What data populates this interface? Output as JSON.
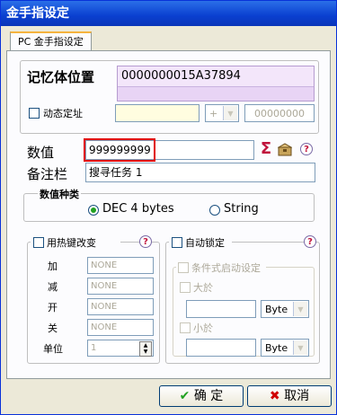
{
  "window": {
    "title": "金手指设定"
  },
  "tab": {
    "label": "PC 金手指设定"
  },
  "memory": {
    "label": "记忆体位置",
    "address": "0000000015A37894",
    "dynamic_label": "动态定址",
    "offset_sign": "+",
    "offset_value": "00000000"
  },
  "value": {
    "label": "数值",
    "input": "999999999"
  },
  "note": {
    "label": "备注栏",
    "input": "搜寻任务 1"
  },
  "value_type": {
    "legend": "数值种类",
    "options": [
      "DEC 4 bytes",
      "String"
    ],
    "selected": "DEC 4 bytes"
  },
  "hotkey": {
    "label": "用热键改变",
    "rows": [
      {
        "label": "加",
        "placeholder": "NONE"
      },
      {
        "label": "减",
        "placeholder": "NONE"
      },
      {
        "label": "开",
        "placeholder": "NONE"
      },
      {
        "label": "关",
        "placeholder": "NONE"
      }
    ],
    "unit_label": "单位",
    "unit_value": "1"
  },
  "autolock": {
    "label": "自动锁定",
    "conditional_label": "条件式启动设定",
    "greater_label": "大於",
    "less_label": "小於",
    "greater_type": "Byte",
    "less_type": "Byte"
  },
  "buttons": {
    "ok": "确 定",
    "cancel": "取消"
  },
  "colors": {
    "title_bar": "#0a3fd0",
    "address_bg": "#e8d4f5",
    "highlight_border": "#e00000",
    "ok_check": "#21a121",
    "cancel_x": "#d00000"
  }
}
